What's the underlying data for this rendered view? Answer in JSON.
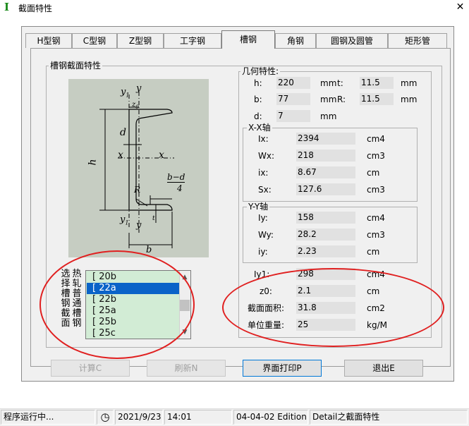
{
  "window": {
    "title": "截面特性",
    "app_icon": "I",
    "close_glyph": "✕"
  },
  "tabs": [
    {
      "label": "H型钢",
      "active": false
    },
    {
      "label": "C型钢",
      "active": false
    },
    {
      "label": "Z型钢",
      "active": false
    },
    {
      "label": "工字钢",
      "active": false
    },
    {
      "label": "槽钢",
      "active": true
    },
    {
      "label": "角钢",
      "active": false
    },
    {
      "label": "圆钢及圆管",
      "active": false
    },
    {
      "label": "矩形管",
      "active": false
    }
  ],
  "section_group": {
    "title": "槽钢截面特性"
  },
  "diagram": {
    "labels": {
      "y1_top": "y",
      "y1_top_sub": "1",
      "y_top": "y",
      "z0": "z",
      "z0_sub": "0",
      "d": "d",
      "h": "h",
      "x_left": "x",
      "x_right": "x",
      "R": "R",
      "bd4_top": "b−d",
      "bd4_bottom": "4",
      "y1_bottom": "y",
      "y1_bottom_sub": "1",
      "y_bottom": "y",
      "t": "t",
      "b": "b"
    }
  },
  "geometry": {
    "title": "几何特性:",
    "h": {
      "label": "h:",
      "value": "220",
      "unit": "mm"
    },
    "t": {
      "label": "t:",
      "value": "11.5",
      "unit": "mm"
    },
    "b": {
      "label": "b:",
      "value": "77",
      "unit": "mm"
    },
    "R": {
      "label": "R:",
      "value": "11.5",
      "unit": "mm"
    },
    "d": {
      "label": "d:",
      "value": "7",
      "unit": "mm"
    }
  },
  "xx_axis": {
    "title": "X-X轴",
    "Ix": {
      "label": "Ix:",
      "value": "2394",
      "unit": "cm4"
    },
    "Wx": {
      "label": "Wx:",
      "value": "218",
      "unit": "cm3"
    },
    "ix": {
      "label": "ix:",
      "value": "8.67",
      "unit": "cm"
    },
    "Sx": {
      "label": "Sx:",
      "value": "127.6",
      "unit": "cm3"
    }
  },
  "yy_axis": {
    "title": "Y-Y轴",
    "Iy": {
      "label": "Iy:",
      "value": "158",
      "unit": "cm4"
    },
    "Wy": {
      "label": "Wy:",
      "value": "28.2",
      "unit": "cm3"
    },
    "iy": {
      "label": "iy:",
      "value": "2.23",
      "unit": "cm"
    }
  },
  "extra": {
    "Iy1": {
      "label": "Iy1:",
      "value": "298",
      "unit": "cm4"
    },
    "z0": {
      "label": "z0:",
      "value": "2.1",
      "unit": "cm"
    },
    "area": {
      "label": "截面面积:",
      "value": "31.8",
      "unit": "cm2"
    },
    "weight": {
      "label": "单位重量:",
      "value": "25",
      "unit": "kg/M"
    }
  },
  "selector": {
    "vertical_label_cols": [
      "选择槽钢截面",
      "热轧普通槽钢"
    ],
    "items": [
      {
        "label": "[  20b",
        "selected": false
      },
      {
        "label": "[  22a",
        "selected": true
      },
      {
        "label": "[  22b",
        "selected": false
      },
      {
        "label": "[  25a",
        "selected": false
      },
      {
        "label": "[  25b",
        "selected": false
      },
      {
        "label": "[  25c",
        "selected": false
      }
    ],
    "scroll_up": "▲",
    "scroll_down": "▼"
  },
  "buttons": {
    "calc": {
      "label": "计算C",
      "enabled": false
    },
    "refresh": {
      "label": "刷新N",
      "enabled": false
    },
    "print": {
      "label": "界面打印P",
      "enabled": true
    },
    "exit": {
      "label": "退出E",
      "enabled": true
    }
  },
  "status": {
    "message": "程序运行中...",
    "clock_icon": "◷",
    "date": "2021/9/23",
    "time": "14:01",
    "edition": "04-04-02 Edition",
    "detail": "Detail之截面特性"
  },
  "colors": {
    "diagram_bg": "#c6cdc2",
    "list_bg": "#d2ecd5",
    "list_selected": "#0a63c8",
    "annotation": "#e02020",
    "app_icon": "#1a8a1a"
  }
}
